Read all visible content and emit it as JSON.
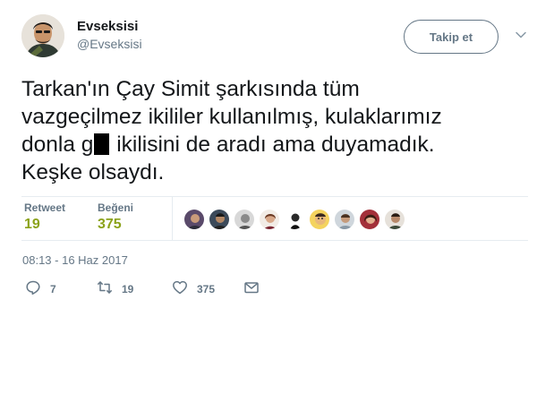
{
  "user": {
    "name": "Evseksisi",
    "handle": "@Evseksisi",
    "follow_label": "Takip et"
  },
  "tweet": {
    "text_line1": "Tarkan'ın Çay Simit şarkısında tüm",
    "text_line2": "vazgeçilmez ikililer kullanılmış, kulaklarımız",
    "text_line3_a": "donla g",
    "text_line3_b": " ikilisini de aradı ama duyamadık.",
    "text_line4": "Keşke olsaydı."
  },
  "stats": {
    "retweet_label": "Retweet",
    "retweet_count": "19",
    "likes_label": "Beğeni",
    "likes_count": "375"
  },
  "timestamp": "08:13 - 16 Haz 2017",
  "actions": {
    "reply_count": "7",
    "retweet_count": "19",
    "like_count": "375"
  },
  "colors": {
    "text": "#14171a",
    "muted": "#657786",
    "stat_value": "#8ba21a",
    "divider": "#e6ecf0"
  },
  "icons": [
    "chevron-down-icon",
    "reply-icon",
    "retweet-icon",
    "heart-icon",
    "envelope-icon"
  ]
}
